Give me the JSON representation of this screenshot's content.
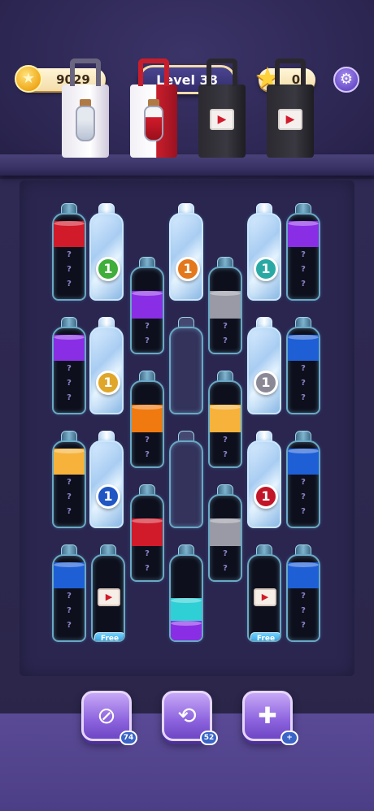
{
  "hud": {
    "coins": "9029",
    "level": "Level 38",
    "stars": "0"
  },
  "shop": {
    "items": [
      {
        "name": "white-potion-bag"
      },
      {
        "name": "red-potion-bag"
      },
      {
        "name": "video-bag-1"
      },
      {
        "name": "video-bag-2"
      }
    ]
  },
  "bottles": {
    "hidden_marker": "?",
    "frozen_counts": [
      "1",
      "1",
      "1",
      "1",
      "1",
      "1",
      "1"
    ],
    "free_label": "Free"
  },
  "colors": {
    "red": "#d11a2a",
    "purple": "#8a2ee6",
    "blue": "#1e5fd6",
    "orange": "#f07a10",
    "yellow": "#f6b23a",
    "gray": "#9a9aa6",
    "cyan": "#2fcfd6",
    "lock_green": "#3fae3a",
    "lock_orange": "#e4781c",
    "lock_teal": "#2aa9a4",
    "lock_gold": "#e0a62a",
    "lock_gray": "#8b8896",
    "lock_blue": "#1f56c4",
    "lock_red": "#c21628"
  },
  "boosters": {
    "undo_count": "74",
    "shuffle_count": "52",
    "add_bottle_badge": "+"
  }
}
